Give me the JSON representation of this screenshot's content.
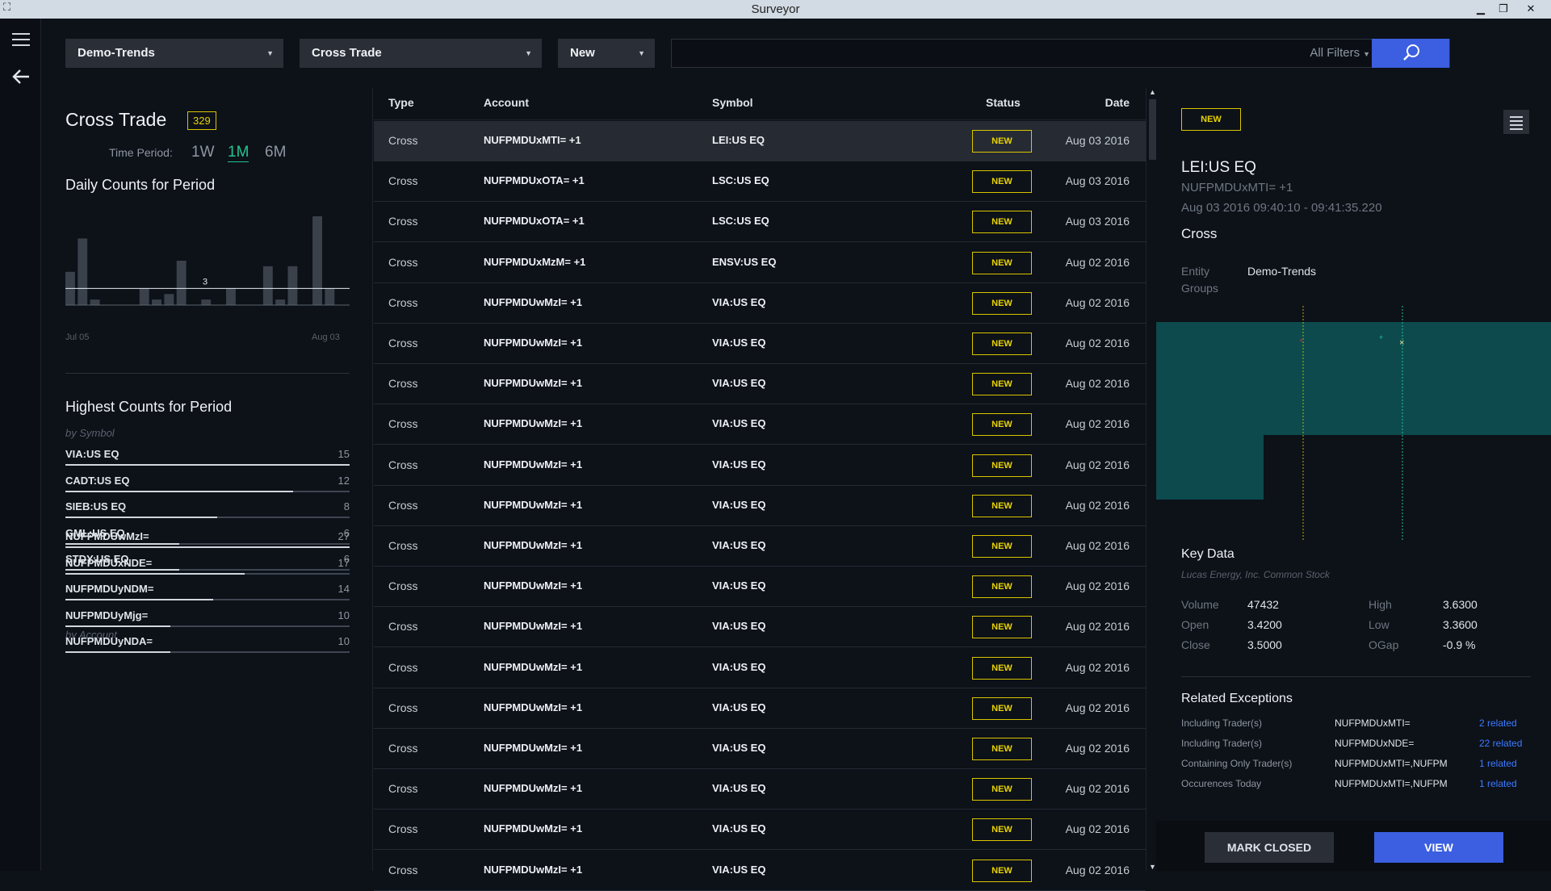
{
  "window": {
    "title": "Surveyor"
  },
  "toolbar": {
    "entity": "Demo-Trends",
    "exception_type": "Cross Trade",
    "status": "New",
    "search_value": "",
    "filters_label": "All Filters"
  },
  "summary": {
    "title": "Cross Trade",
    "count": "329",
    "time_period_label": "Time Period:",
    "periods": [
      "1W",
      "1M",
      "6M"
    ],
    "selected_period": "1M",
    "daily_title": "Daily Counts for Period",
    "highest_title": "Highest Counts for Period",
    "by_symbol_label": "by Symbol",
    "by_account_label": "by Account"
  },
  "chart_data": {
    "type": "bar",
    "title": "Daily Counts for Period",
    "x_start_label": "Jul 05",
    "x_end_label": "Aug 03",
    "values": [
      6,
      12,
      1,
      0,
      0,
      0,
      3,
      1,
      2,
      8,
      0,
      1,
      0,
      3,
      0,
      0,
      7,
      1,
      7,
      0,
      16,
      3,
      0
    ],
    "average": 3,
    "average_label": "3"
  },
  "by_symbol": [
    {
      "name": "VIA:US EQ",
      "count": 15
    },
    {
      "name": "CADT:US EQ",
      "count": 12
    },
    {
      "name": "SIEB:US EQ",
      "count": 8
    },
    {
      "name": "GML:US EQ",
      "count": 6
    },
    {
      "name": "STDY:US EQ",
      "count": 6
    }
  ],
  "by_account": [
    {
      "name": "NUFPMDUwMzI=",
      "count": 27
    },
    {
      "name": "NUFPMDUxNDE=",
      "count": 17
    },
    {
      "name": "NUFPMDUyNDM=",
      "count": 14
    },
    {
      "name": "NUFPMDUyMjg=",
      "count": 10
    },
    {
      "name": "NUFPMDUyNDA=",
      "count": 10
    }
  ],
  "grid": {
    "columns": [
      "Type",
      "Account",
      "Symbol",
      "Status",
      "Date"
    ],
    "rows": [
      {
        "type": "Cross",
        "account": "NUFPMDUxMTI=  +1",
        "symbol": "LEI:US EQ",
        "status": "NEW",
        "date": "Aug 03 2016"
      },
      {
        "type": "Cross",
        "account": "NUFPMDUxOTA=  +1",
        "symbol": "LSC:US EQ",
        "status": "NEW",
        "date": "Aug 03 2016"
      },
      {
        "type": "Cross",
        "account": "NUFPMDUxOTA=  +1",
        "symbol": "LSC:US EQ",
        "status": "NEW",
        "date": "Aug 03 2016"
      },
      {
        "type": "Cross",
        "account": "NUFPMDUxMzM=  +1",
        "symbol": "ENSV:US EQ",
        "status": "NEW",
        "date": "Aug 02 2016"
      },
      {
        "type": "Cross",
        "account": "NUFPMDUwMzI=  +1",
        "symbol": "VIA:US EQ",
        "status": "NEW",
        "date": "Aug 02 2016"
      },
      {
        "type": "Cross",
        "account": "NUFPMDUwMzI=  +1",
        "symbol": "VIA:US EQ",
        "status": "NEW",
        "date": "Aug 02 2016"
      },
      {
        "type": "Cross",
        "account": "NUFPMDUwMzI=  +1",
        "symbol": "VIA:US EQ",
        "status": "NEW",
        "date": "Aug 02 2016"
      },
      {
        "type": "Cross",
        "account": "NUFPMDUwMzI=  +1",
        "symbol": "VIA:US EQ",
        "status": "NEW",
        "date": "Aug 02 2016"
      },
      {
        "type": "Cross",
        "account": "NUFPMDUwMzI=  +1",
        "symbol": "VIA:US EQ",
        "status": "NEW",
        "date": "Aug 02 2016"
      },
      {
        "type": "Cross",
        "account": "NUFPMDUwMzI=  +1",
        "symbol": "VIA:US EQ",
        "status": "NEW",
        "date": "Aug 02 2016"
      },
      {
        "type": "Cross",
        "account": "NUFPMDUwMzI=  +1",
        "symbol": "VIA:US EQ",
        "status": "NEW",
        "date": "Aug 02 2016"
      },
      {
        "type": "Cross",
        "account": "NUFPMDUwMzI=  +1",
        "symbol": "VIA:US EQ",
        "status": "NEW",
        "date": "Aug 02 2016"
      },
      {
        "type": "Cross",
        "account": "NUFPMDUwMzI=  +1",
        "symbol": "VIA:US EQ",
        "status": "NEW",
        "date": "Aug 02 2016"
      },
      {
        "type": "Cross",
        "account": "NUFPMDUwMzI=  +1",
        "symbol": "VIA:US EQ",
        "status": "NEW",
        "date": "Aug 02 2016"
      },
      {
        "type": "Cross",
        "account": "NUFPMDUwMzI=  +1",
        "symbol": "VIA:US EQ",
        "status": "NEW",
        "date": "Aug 02 2016"
      },
      {
        "type": "Cross",
        "account": "NUFPMDUwMzI=  +1",
        "symbol": "VIA:US EQ",
        "status": "NEW",
        "date": "Aug 02 2016"
      },
      {
        "type": "Cross",
        "account": "NUFPMDUwMzI=  +1",
        "symbol": "VIA:US EQ",
        "status": "NEW",
        "date": "Aug 02 2016"
      },
      {
        "type": "Cross",
        "account": "NUFPMDUwMzI=  +1",
        "symbol": "VIA:US EQ",
        "status": "NEW",
        "date": "Aug 02 2016"
      },
      {
        "type": "Cross",
        "account": "NUFPMDUwMzI=  +1",
        "symbol": "VIA:US EQ",
        "status": "NEW",
        "date": "Aug 02 2016"
      }
    ]
  },
  "detail": {
    "status": "NEW",
    "symbol": "LEI:US EQ",
    "account": "NUFPMDUxMTI=  +1",
    "time": "Aug 03 2016 09:40:10 - 09:41:35.220",
    "type": "Cross",
    "entity_label": "Entity",
    "entity_value": "Demo-Trends",
    "groups_label": "Groups",
    "key_data_title": "Key Data",
    "company": "Lucas Energy, Inc. Common Stock",
    "key_data": [
      {
        "label": "Volume",
        "value": "47432"
      },
      {
        "label": "High",
        "value": "3.6300"
      },
      {
        "label": "Open",
        "value": "3.4200"
      },
      {
        "label": "Low",
        "value": "3.3600"
      },
      {
        "label": "Close",
        "value": "3.5000"
      },
      {
        "label": "OGap",
        "value": "-0.9 %"
      }
    ],
    "related_title": "Related Exceptions",
    "related": [
      {
        "label": "Including Trader(s)",
        "value": "NUFPMDUxMTI=",
        "link": "2 related"
      },
      {
        "label": "Including Trader(s)",
        "value": "NUFPMDUxNDE=",
        "link": "22 related"
      },
      {
        "label": "Containing Only Trader(s)",
        "value": "NUFPMDUxMTI=,NUFPM",
        "link": "1 related"
      },
      {
        "label": "Occurences Today",
        "value": "NUFPMDUxMTI=,NUFPM",
        "link": "1 related"
      }
    ],
    "mark_closed_label": "MARK CLOSED",
    "view_label": "VIEW"
  },
  "colors": {
    "accent": "#3b5fe0",
    "status_new": "#e8d300",
    "period_active": "#23c48e",
    "price_band": "#0c4a4e"
  }
}
